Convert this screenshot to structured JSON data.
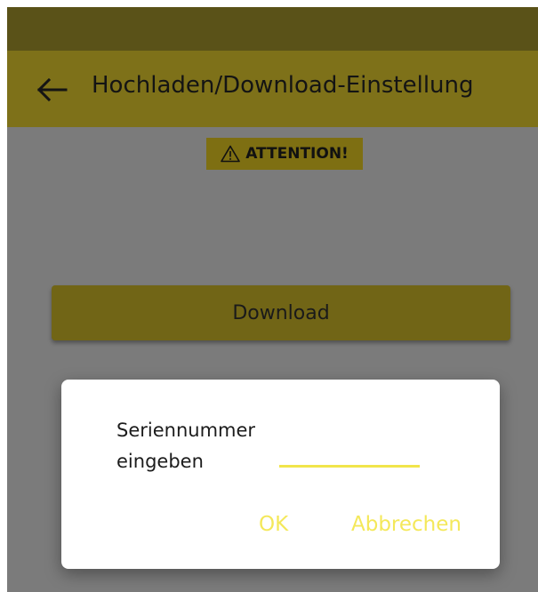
{
  "header": {
    "title": "Hochladen/Download-Einstellung",
    "back_icon": "arrow-left-icon"
  },
  "attention": {
    "icon": "warning-triangle-icon",
    "label": "ATTENTION!"
  },
  "main": {
    "download_label": "Download"
  },
  "dialog": {
    "label_line1": "Seriennummer",
    "label_line2": "eingeben",
    "input_value": "",
    "ok_label": "OK",
    "cancel_label": "Abbrechen"
  },
  "colors": {
    "app_bar": "#7e7119",
    "status_bar": "#5a5218",
    "accent": "#f4e85a",
    "scrim_background": "#7b7b7b",
    "dialog_background": "#ffffff"
  }
}
